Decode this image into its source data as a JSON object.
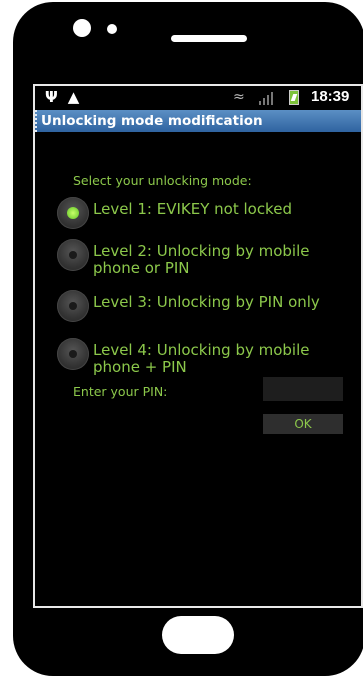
{
  "status_bar": {
    "icons": [
      "usb-icon",
      "warning-icon",
      "wifi-icon",
      "signal-icon",
      "battery-icon"
    ],
    "time": "18:39"
  },
  "title_bar": {
    "title": "Unlocking mode modification",
    "color": "#3f74b2"
  },
  "main": {
    "prompt": "Select your unlocking mode:",
    "options": [
      {
        "label": "Level 1: EVIKEY not locked",
        "selected": true
      },
      {
        "label": "Level 2: Unlocking by mobile phone or PIN",
        "selected": false
      },
      {
        "label": "Level 3: Unlocking by PIN only",
        "selected": false
      },
      {
        "label": "Level 4: Unlocking by mobile phone + PIN",
        "selected": false
      }
    ],
    "pin_label": "Enter your PIN:",
    "pin_value": "",
    "ok_label": "OK",
    "text_color": "#8cc84b"
  }
}
